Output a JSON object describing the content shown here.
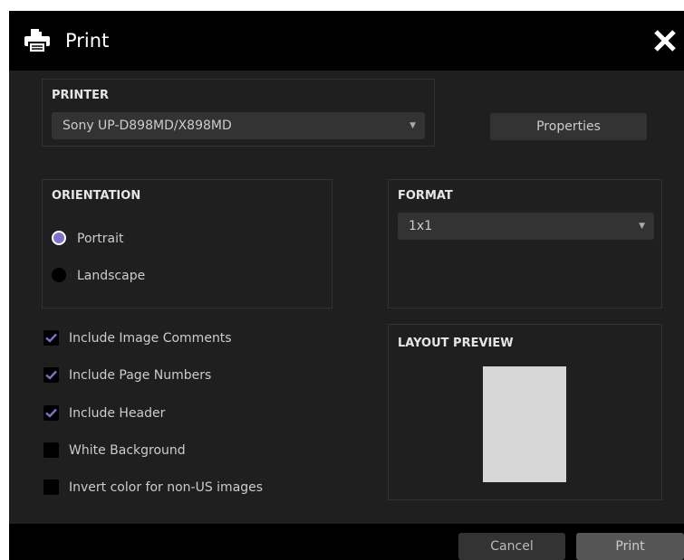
{
  "dialog": {
    "title": "Print",
    "icons": {
      "title": "printer-icon",
      "close": "close-icon"
    }
  },
  "printer": {
    "section_title": "PRINTER",
    "selected": "Sony UP-D898MD/X898MD",
    "properties_label": "Properties"
  },
  "orientation": {
    "section_title": "ORIENTATION",
    "options": [
      {
        "label": "Portrait",
        "selected": true
      },
      {
        "label": "Landscape",
        "selected": false
      }
    ]
  },
  "format": {
    "section_title": "FORMAT",
    "selected": "1x1"
  },
  "options": [
    {
      "label": "Include Image Comments",
      "checked": true
    },
    {
      "label": "Include Page Numbers",
      "checked": true
    },
    {
      "label": "Include Header",
      "checked": true
    },
    {
      "label": "White Background",
      "checked": false
    },
    {
      "label": "Invert color for non-US images",
      "checked": false
    }
  ],
  "layout_preview": {
    "section_title": "LAYOUT PREVIEW"
  },
  "footer": {
    "cancel_label": "Cancel",
    "print_label": "Print"
  },
  "colors": {
    "accent": "#7b72cc",
    "dialog_bg": "#1f1f1f",
    "titlebar_bg": "#000000"
  }
}
